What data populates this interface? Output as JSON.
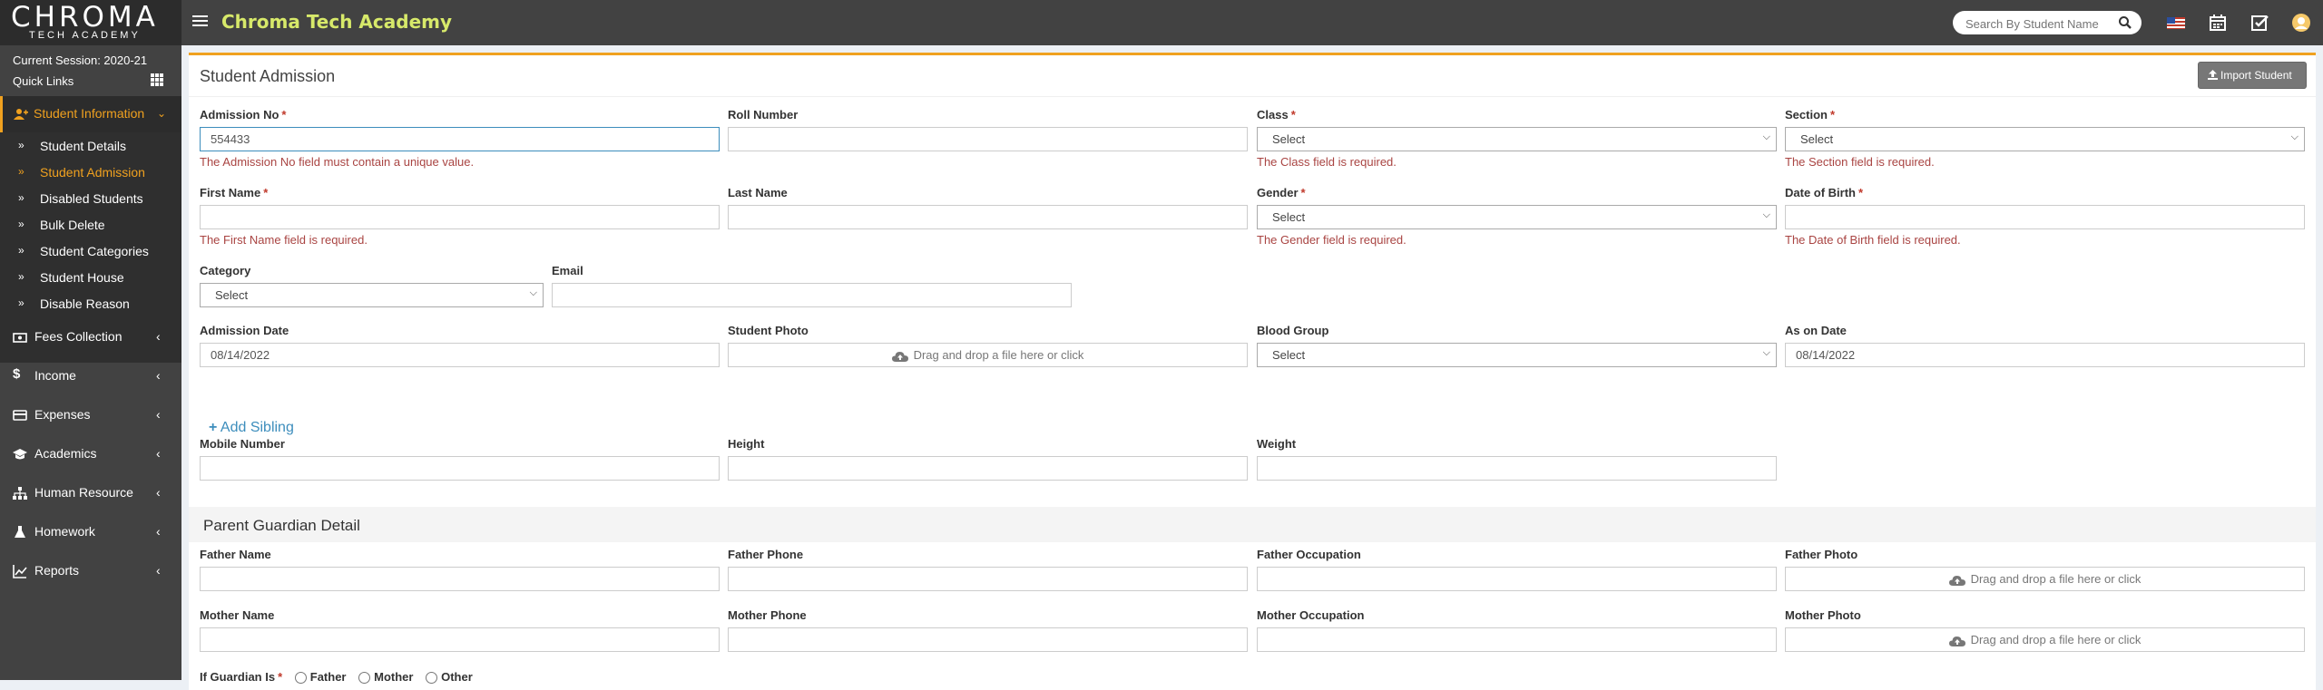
{
  "topbar": {
    "logo_text": "CHROMA",
    "logo_sub": "TECH ACADEMY",
    "brand": "Chroma Tech Academy",
    "search_placeholder": "Search By Student Name",
    "icons": [
      "menu-icon",
      "search-icon",
      "us-flag-icon",
      "calendar-icon",
      "task-check-icon",
      "user-avatar-icon"
    ]
  },
  "sidebar": {
    "session": "Current Session: 2020-21",
    "quick_links": "Quick Links",
    "active_menu": "Student Information",
    "sub_items": [
      {
        "label": "Student Details"
      },
      {
        "label": "Student Admission"
      },
      {
        "label": "Disabled Students"
      },
      {
        "label": "Bulk Delete"
      },
      {
        "label": "Student Categories"
      },
      {
        "label": "Student House"
      },
      {
        "label": "Disable Reason"
      }
    ],
    "menu_items": [
      {
        "label": "Fees Collection"
      },
      {
        "label": "Income"
      },
      {
        "label": "Expenses"
      },
      {
        "label": "Academics"
      },
      {
        "label": "Human Resource"
      },
      {
        "label": "Homework"
      },
      {
        "label": "Reports"
      }
    ]
  },
  "form": {
    "title": "Student Admission",
    "import_button": "Import Student",
    "fields": {
      "admission_no": {
        "label": "Admission No",
        "value": "554433",
        "error": "The Admission No field must contain a unique value."
      },
      "roll_number": {
        "label": "Roll Number"
      },
      "class": {
        "label": "Class",
        "value": "Select",
        "error": "The Class field is required."
      },
      "section": {
        "label": "Section",
        "value": "Select",
        "error": "The Section field is required."
      },
      "first_name": {
        "label": "First Name",
        "error": "The First Name field is required."
      },
      "last_name": {
        "label": "Last Name"
      },
      "gender": {
        "label": "Gender",
        "value": "Select",
        "error": "The Gender field is required."
      },
      "dob": {
        "label": "Date of Birth",
        "error": "The Date of Birth field is required."
      },
      "category": {
        "label": "Category",
        "value": "Select"
      },
      "email": {
        "label": "Email"
      },
      "admission_date": {
        "label": "Admission Date",
        "value": "08/14/2022"
      },
      "student_photo": {
        "label": "Student Photo",
        "drop_text": "Drag and drop a file here or click"
      },
      "blood_group": {
        "label": "Blood Group",
        "value": "Select"
      },
      "as_on_date": {
        "label": "As on Date",
        "value": "08/14/2022"
      },
      "add_sibling": "Add Sibling",
      "mobile_number": {
        "label": "Mobile Number"
      },
      "height": {
        "label": "Height"
      },
      "weight": {
        "label": "Weight"
      }
    },
    "guardian_section": "Parent Guardian Detail",
    "guardian_fields": {
      "father_name": "Father Name",
      "father_phone": "Father Phone",
      "father_occupation": "Father Occupation",
      "father_photo": "Father Photo",
      "mother_name": "Mother Name",
      "mother_phone": "Mother Phone",
      "mother_occupation": "Mother Occupation",
      "mother_photo": "Mother Photo",
      "drop_text": "Drag and drop a file here or click"
    },
    "guardian_is": {
      "label": "If Guardian Is",
      "options": [
        "Father",
        "Mother",
        "Other"
      ]
    }
  },
  "colors": {
    "accent": "#f0a11f",
    "brand": "#d7e96a",
    "error": "#a94442",
    "sidebar": "#424242",
    "link": "#3c8dbc"
  }
}
